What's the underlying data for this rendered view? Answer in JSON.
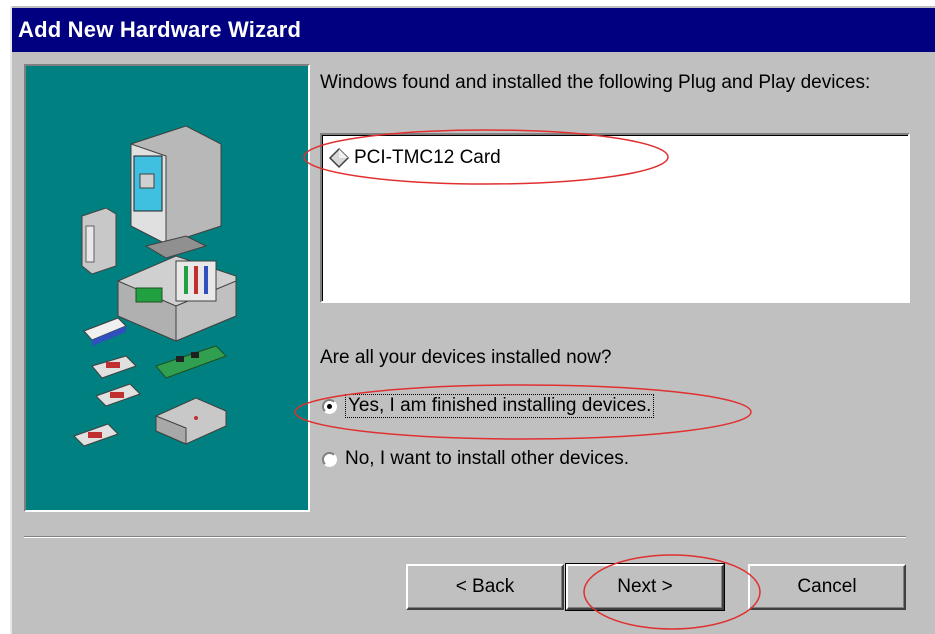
{
  "window": {
    "title": "Add New Hardware Wizard"
  },
  "main": {
    "found_text": "Windows found and installed the following Plug and Play devices:",
    "devices": [
      {
        "name": "PCI-TMC12 Card",
        "icon": "device-diamond-icon"
      }
    ],
    "question": "Are all your devices installed now?",
    "options": [
      {
        "label": "Yes, I am finished installing devices.",
        "selected": true
      },
      {
        "label": "No, I want to install other devices.",
        "selected": false
      }
    ]
  },
  "buttons": {
    "back_label": "< Back",
    "next_label": "Next >",
    "cancel_label": "Cancel"
  },
  "colors": {
    "titlebar": "#000080",
    "dialog": "#c0c0c0",
    "illustration": "#008080",
    "annotation": "#e03030"
  }
}
